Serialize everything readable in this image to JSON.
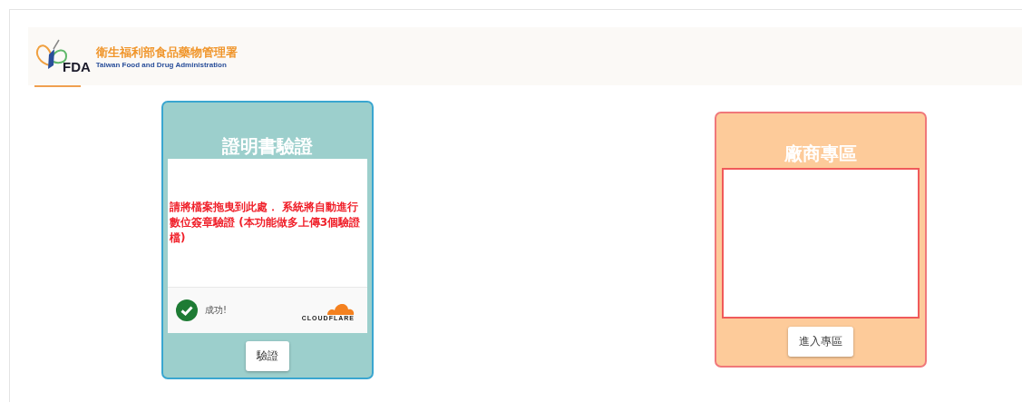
{
  "header": {
    "logo_text": "FDA",
    "title": "衛生福利部食品藥物管理署",
    "subtitle": "Taiwan Food and Drug Administration"
  },
  "cards": [
    {
      "kind": "upload",
      "title": "證明書驗證",
      "drop_text": "請將檔案拖曳到此處． 系統將自動進行數位簽章驗證 (本功能做多上傳3個驗證檔)",
      "captcha": {
        "status": "成功!",
        "verified": true,
        "brand": "CLOUDFLARE"
      },
      "button": "驗證"
    },
    {
      "kind": "vendor",
      "title": "廠商專區",
      "button": "進入專區"
    }
  ]
}
